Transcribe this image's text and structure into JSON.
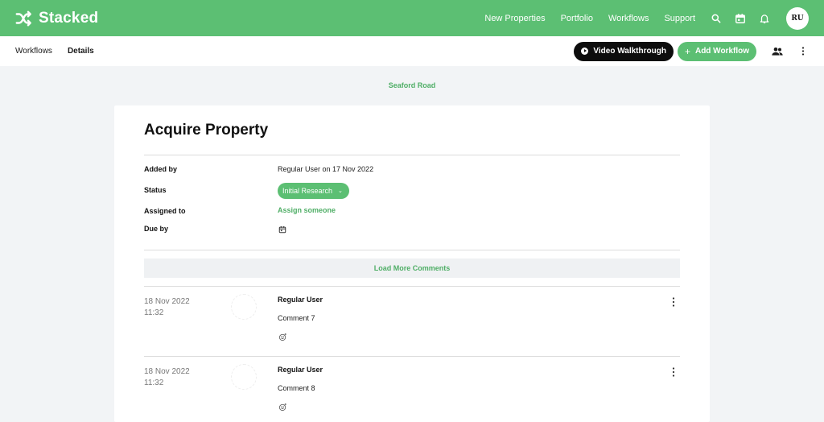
{
  "app": {
    "name": "Stacked"
  },
  "nav": {
    "links": [
      "New Properties",
      "Portfolio",
      "Workflows",
      "Support"
    ],
    "user_initials": "RU"
  },
  "subnav": {
    "crumbs": [
      "Workflows",
      "Details"
    ],
    "video_label": "Video Walkthrough",
    "add_label": "Add Workflow"
  },
  "property": {
    "name": "Seaford Road"
  },
  "workflow": {
    "title": "Acquire Property",
    "fields": {
      "added_by_label": "Added by",
      "added_by_value": "Regular User on 17 Nov 2022",
      "status_label": "Status",
      "status_value": "Initial Research",
      "assigned_label": "Assigned to",
      "assigned_value": "Assign someone",
      "due_label": "Due by"
    },
    "load_more": "Load More Comments",
    "comments": [
      {
        "date": "18 Nov 2022",
        "time": "11:32",
        "author": "Regular User",
        "text": "Comment 7"
      },
      {
        "date": "18 Nov 2022",
        "time": "11:32",
        "author": "Regular User",
        "text": "Comment 8"
      }
    ]
  },
  "colors": {
    "brand": "#5cbf73",
    "brand_text": "#4fae66",
    "dark": "#0d0d0d"
  }
}
